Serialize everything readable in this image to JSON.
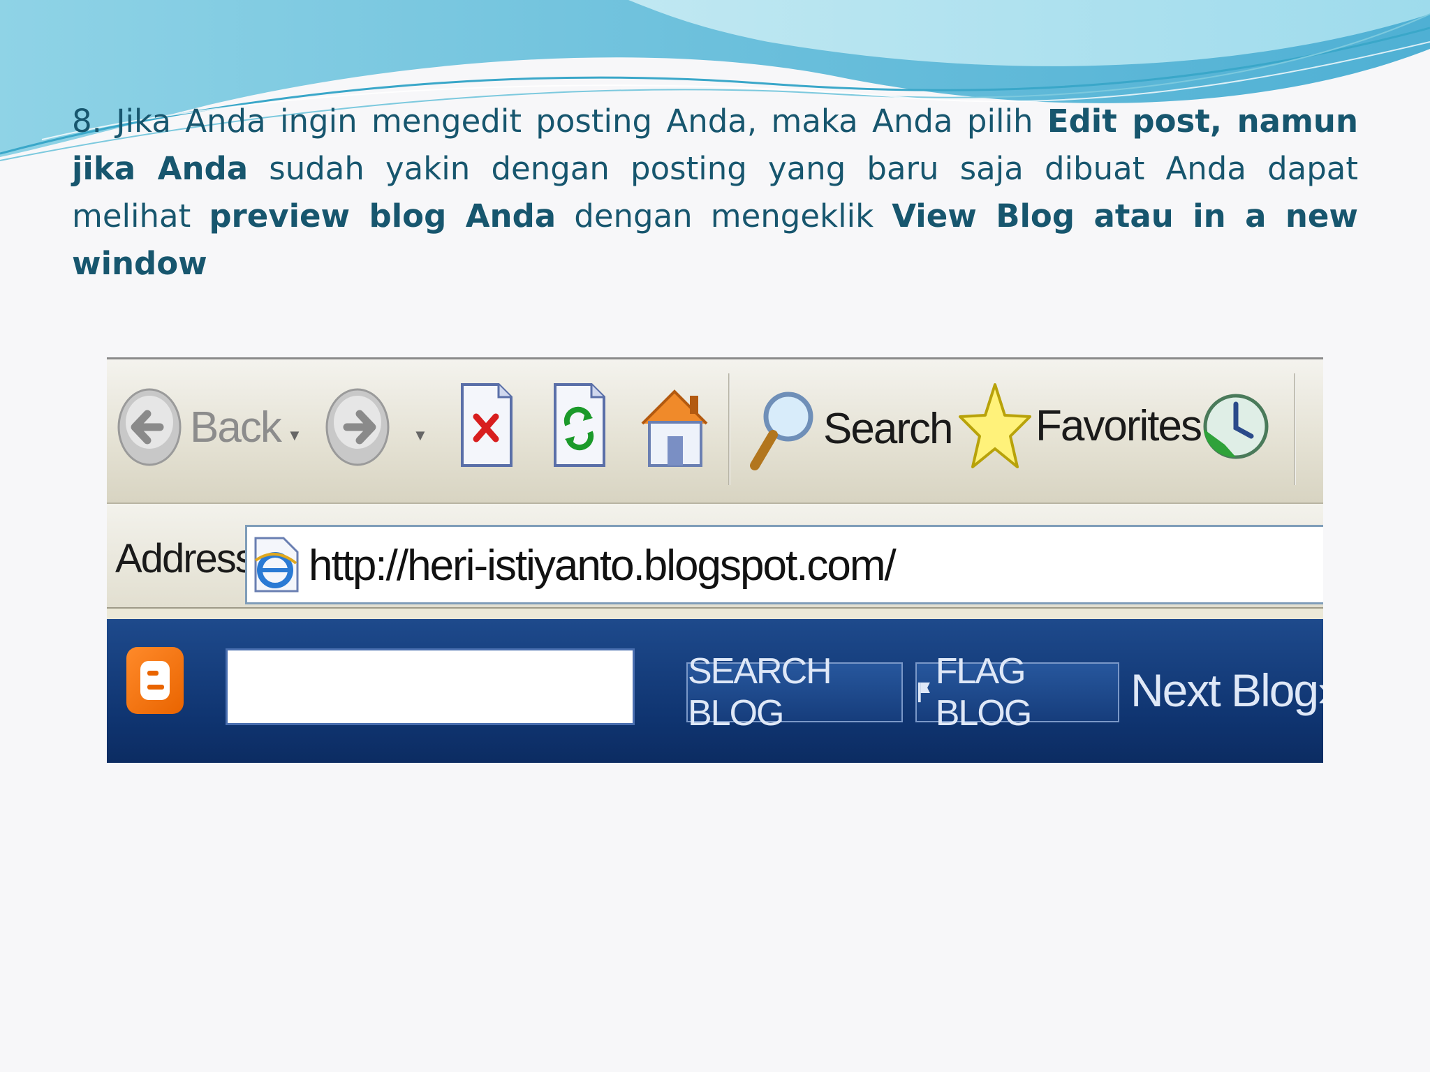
{
  "slide": {
    "paragraph": {
      "p1": "8. Jika Anda ingin mengedit posting Anda, maka Anda pilih ",
      "b1": "Edit post, namun jika Anda",
      "p2": " sudah yakin dengan posting yang baru saja dibuat Anda dapat melihat ",
      "b2": "preview blog Anda",
      "p3": " dengan mengeklik ",
      "b3": "View Blog atau in a new window"
    }
  },
  "browser": {
    "toolbar": {
      "back_label": "Back",
      "dropdown_glyph": "▼",
      "search_label": "Search",
      "favorites_label": "Favorites"
    },
    "address": {
      "label": "Address",
      "url": "http://heri-istiyanto.blogspot.com/"
    },
    "blogger_bar": {
      "search_blog_label": "SEARCH BLOG",
      "flag_blog_label": "FLAG BLOG",
      "next_blog_label": "Next Blog»"
    }
  },
  "colors": {
    "text": "#17566e",
    "navbar": "#0f3470",
    "blogger_orange": "#f57d00"
  }
}
